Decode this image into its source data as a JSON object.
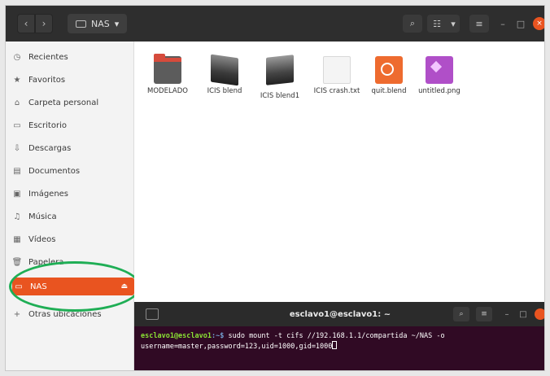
{
  "header": {
    "path_label": "NAS",
    "nav_back": "‹",
    "nav_forward": "›"
  },
  "sidebar": {
    "items": [
      {
        "label": "Recientes",
        "icon": "clock-icon"
      },
      {
        "label": "Favoritos",
        "icon": "star-icon"
      },
      {
        "label": "Carpeta personal",
        "icon": "home-icon"
      },
      {
        "label": "Escritorio",
        "icon": "desktop-icon"
      },
      {
        "label": "Descargas",
        "icon": "download-icon"
      },
      {
        "label": "Documentos",
        "icon": "document-icon"
      },
      {
        "label": "Imágenes",
        "icon": "image-icon"
      },
      {
        "label": "Música",
        "icon": "music-icon"
      },
      {
        "label": "Vídeos",
        "icon": "video-icon"
      },
      {
        "label": "Papelera",
        "icon": "trash-icon"
      },
      {
        "label": "NAS",
        "icon": "network-drive-icon",
        "active": true
      },
      {
        "label": "Otras ubicaciones",
        "icon": "plus-icon"
      }
    ]
  },
  "files": [
    {
      "name": "MODELADO",
      "type": "folder"
    },
    {
      "name": "ICIS blend",
      "type": "blend"
    },
    {
      "name": "ICIS blend1",
      "type": "blend"
    },
    {
      "name": "ICIS crash.txt",
      "type": "text"
    },
    {
      "name": "quit.blend",
      "type": "blender"
    },
    {
      "name": "untitled.png",
      "type": "image"
    }
  ],
  "terminal": {
    "title": "esclavo1@esclavo1: ~",
    "prompt_user": "esclavo1@esclavo1",
    "prompt_path": ":~$",
    "command": " sudo mount -t cifs //192.168.1.1/compartida ~/NAS -o",
    "line2": "username=master,password=123,uid=1000,gid=1000"
  },
  "colors": {
    "accent": "#e95420",
    "annotation": "#1fae55",
    "terminal_bg": "#300a24"
  }
}
